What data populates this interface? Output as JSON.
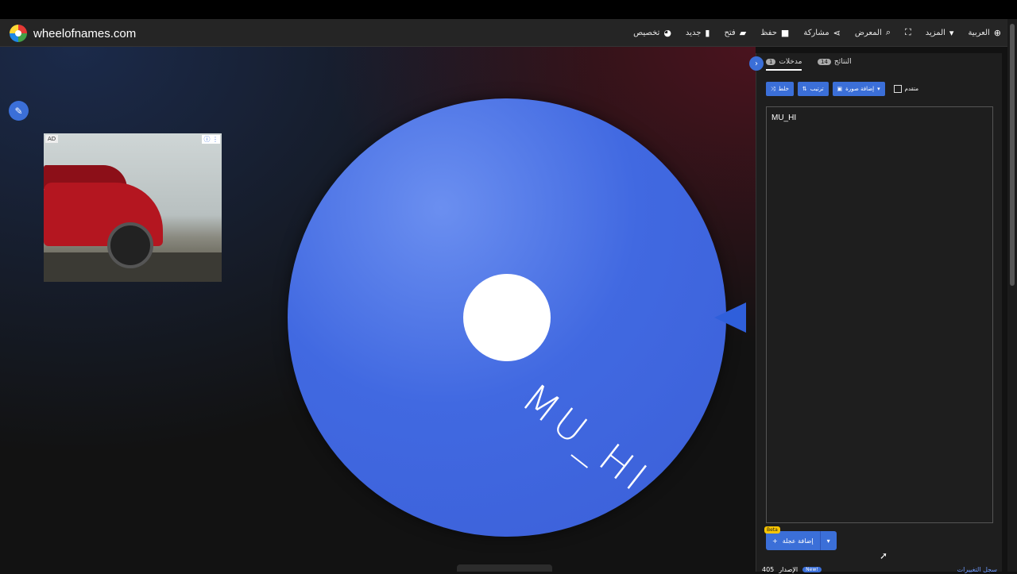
{
  "site": {
    "name": "wheelofnames.com"
  },
  "nav": [
    {
      "label": "العربية",
      "icon": "globe-icon",
      "glyph": "🌐"
    },
    {
      "label": "المزيد",
      "icon": "caret-down-icon",
      "glyph": "▾"
    },
    {
      "label": "",
      "icon": "fullscreen-icon",
      "glyph": "⛶"
    },
    {
      "label": "المعرض",
      "icon": "search-icon",
      "glyph": "🔍"
    },
    {
      "label": "مشاركة",
      "icon": "share-icon",
      "glyph": "⤴"
    },
    {
      "label": "حفظ",
      "icon": "save-icon",
      "glyph": "💾"
    },
    {
      "label": "فتح",
      "icon": "folder-icon",
      "glyph": "📂"
    },
    {
      "label": "جديد",
      "icon": "new-file-icon",
      "glyph": "📄"
    },
    {
      "label": "تخصيص",
      "icon": "palette-icon",
      "glyph": "🎨"
    }
  ],
  "ad": {
    "label": "AD",
    "icons": "ⓘ ⋮"
  },
  "wheel": {
    "segment_label": "MU_HI",
    "color": "#4169e1"
  },
  "panel": {
    "tabs": [
      {
        "label": "مدخلات",
        "count": "1"
      },
      {
        "label": "النتائج",
        "count": "14"
      }
    ],
    "toolbar": {
      "shuffle": "خلط",
      "sort": "ترتيب",
      "add_image": "إضافة صورة",
      "advanced": "متقدم"
    },
    "entries": [
      "MU_HI"
    ],
    "add_wheel": {
      "label": "إضافة عجلة",
      "beta": "Beta"
    },
    "footer": {
      "version": "405",
      "version_label": "الإصدار",
      "new_badge": "New!",
      "changelog": "سجل التغييرات"
    }
  },
  "colors": {
    "accent": "#3b6fd8",
    "background": "#121212",
    "panel": "#1e1e1e"
  }
}
